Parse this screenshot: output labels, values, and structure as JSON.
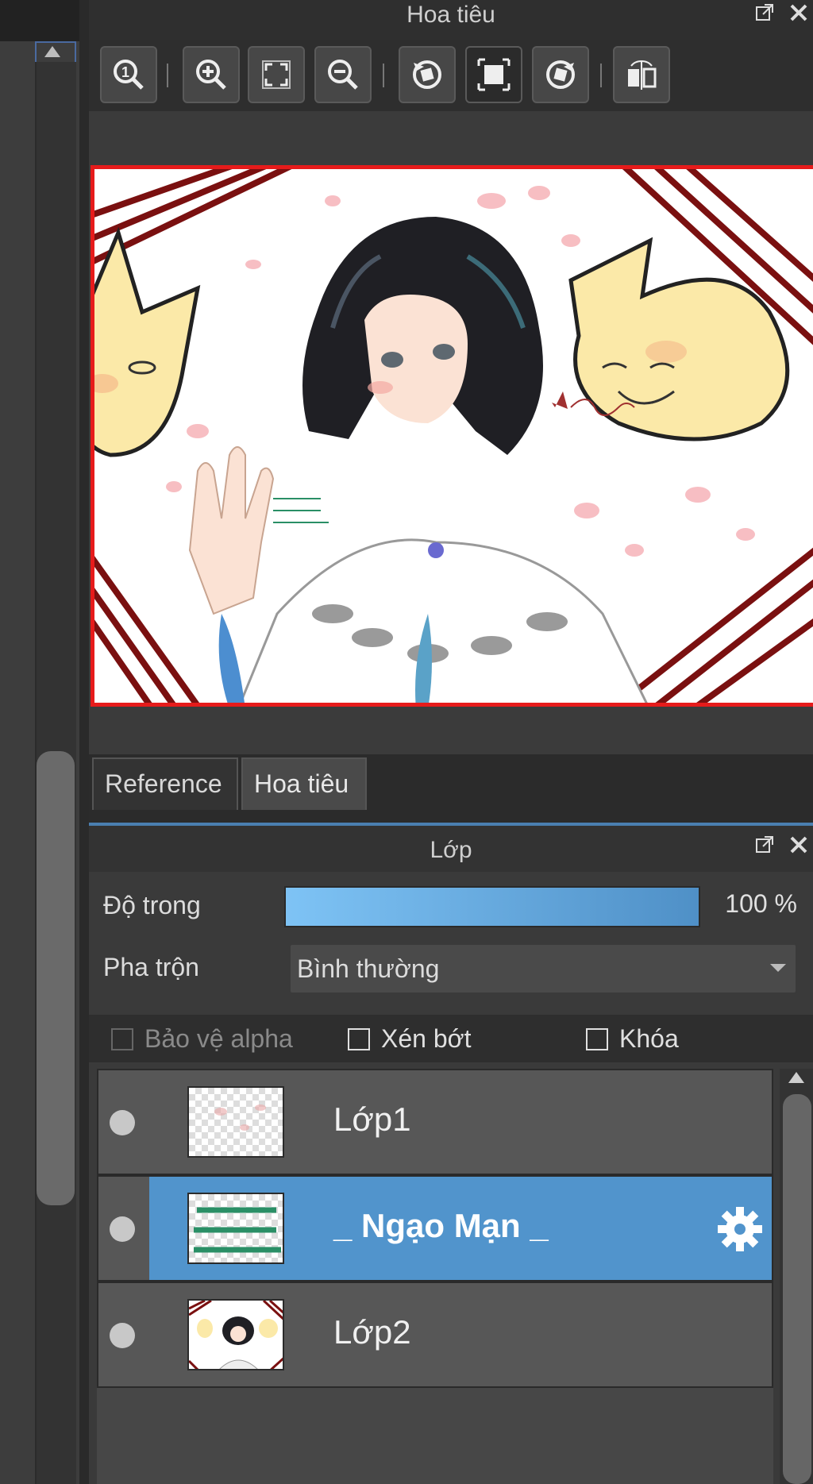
{
  "navigator": {
    "title": "Hoa tiêu",
    "toolbar": [
      {
        "name": "actual-size-icon"
      },
      {
        "name": "zoom-in-icon"
      },
      {
        "name": "fit-to-window-icon"
      },
      {
        "name": "zoom-out-icon"
      },
      {
        "name": "rotate-left-icon"
      },
      {
        "name": "fit-frame-icon"
      },
      {
        "name": "rotate-right-icon"
      },
      {
        "name": "flip-horizontal-icon"
      }
    ],
    "tabs": [
      {
        "label": "Reference"
      },
      {
        "label": "Hoa tiêu"
      }
    ]
  },
  "layers": {
    "title": "Lớp",
    "opacity_label": "Độ trong",
    "opacity_value": "100 %",
    "opacity_fraction": 1.0,
    "blend_label": "Pha trộn",
    "blend_value": "Bình thường",
    "checks": {
      "protect_alpha": "Bảo vệ alpha",
      "clip": "Xén bớt",
      "lock": "Khóa"
    },
    "items": [
      {
        "name": "Lớp1",
        "selected": false
      },
      {
        "name": "_  Ngạo Mạn _",
        "selected": true
      },
      {
        "name": "Lớp2",
        "selected": false
      }
    ]
  },
  "colors": {
    "accent": "#5194cc",
    "frame": "#e61b1b",
    "opacity_start": "#7ec3f5",
    "opacity_end": "#4f90c7"
  }
}
